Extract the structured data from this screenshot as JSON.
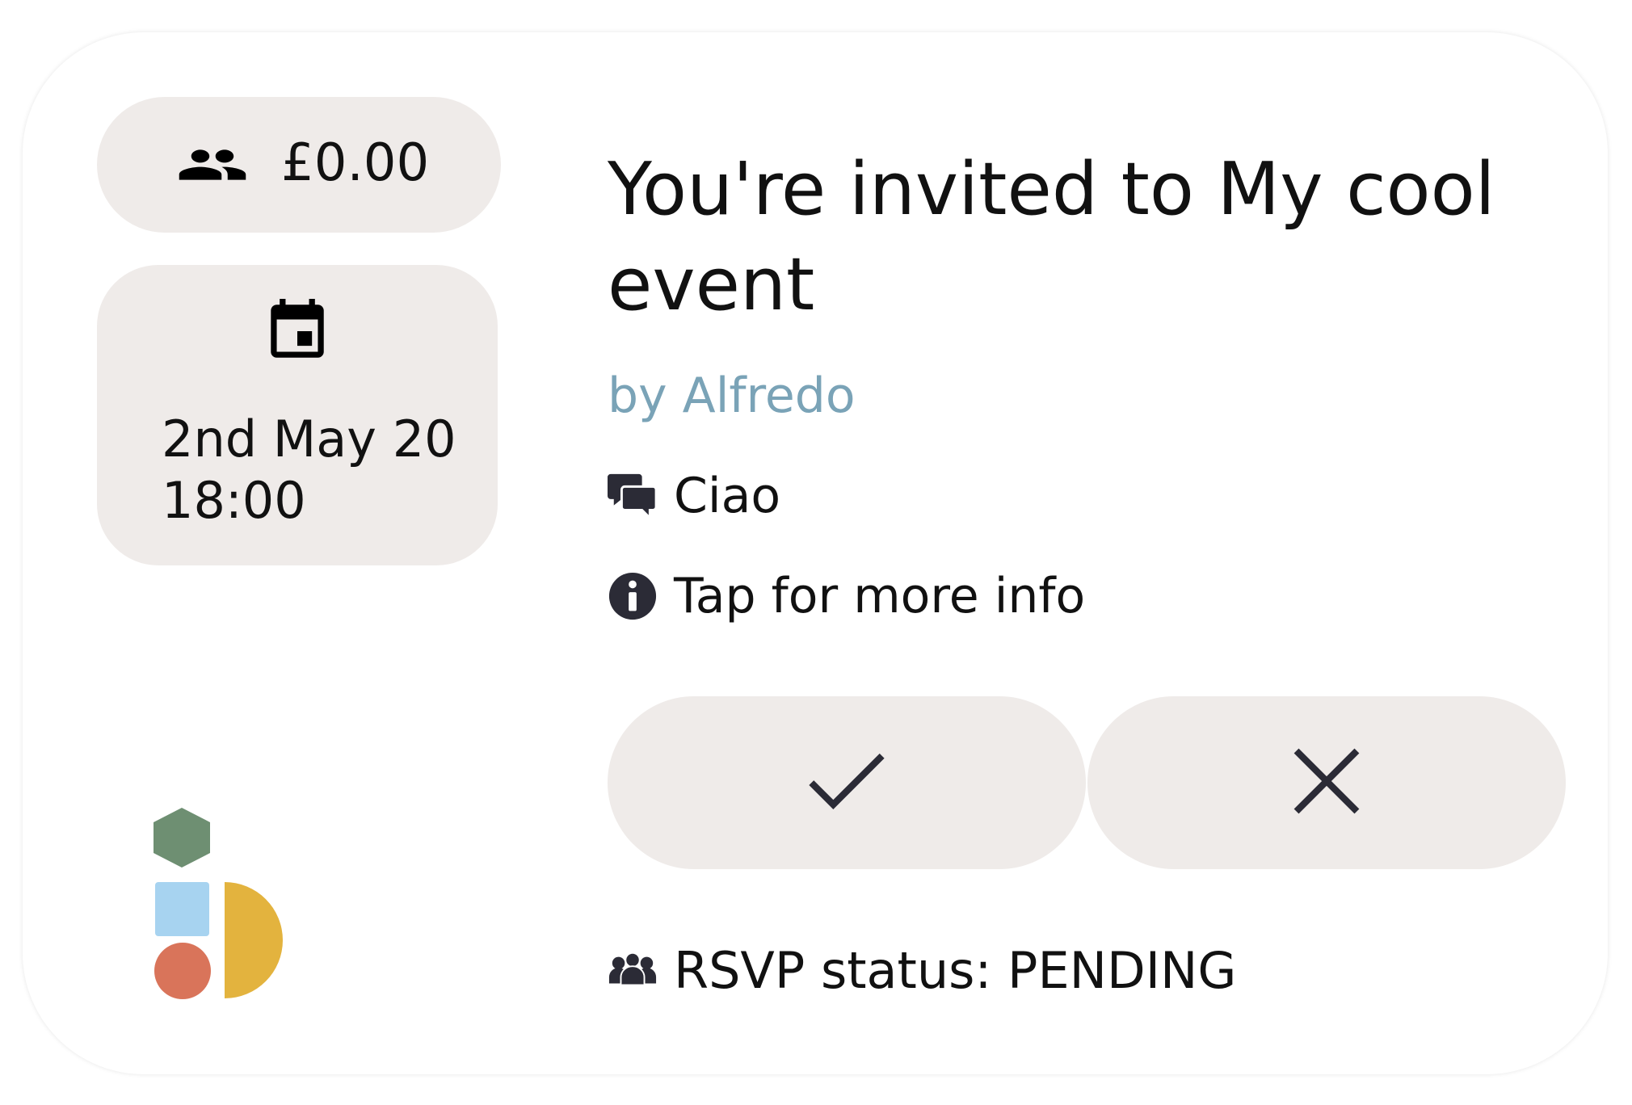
{
  "card": {
    "price": "£0.00",
    "datetime": "2nd May 20\n18:00",
    "title": "You're invited to My cool event",
    "host": "by Alfredo",
    "message": "Ciao",
    "more_info": "Tap for more info",
    "rsvp_status": "RSVP status: PENDING"
  },
  "icons": {
    "price": "group-icon",
    "date": "calendar-icon",
    "message": "chat-icon",
    "info": "info-icon",
    "accept": "check-icon",
    "decline": "close-icon",
    "rsvp": "people-icon"
  },
  "colors": {
    "pill_background": "#efebe9",
    "host_text": "#7aa3b7",
    "icon": "#2b2b36",
    "logo_hexagon": "#6e8f72",
    "logo_square": "#a7d3f0",
    "logo_circle": "#d9745a",
    "logo_half_circle": "#e3b33e"
  }
}
